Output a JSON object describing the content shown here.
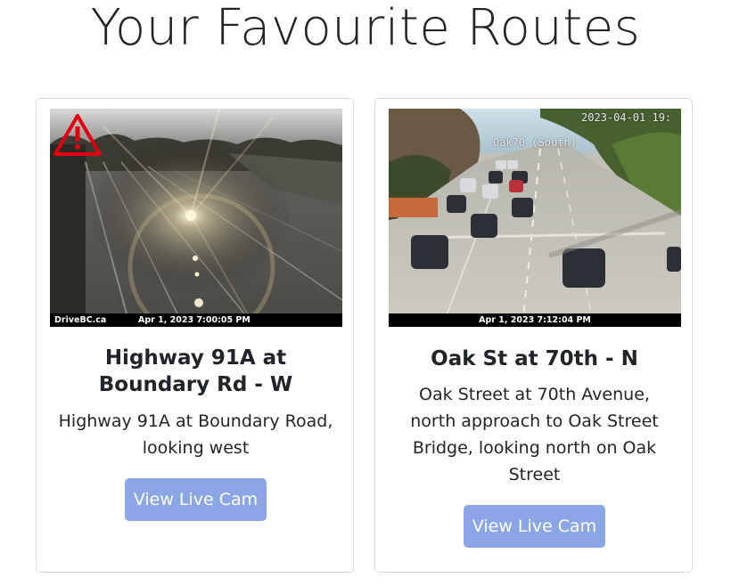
{
  "page": {
    "title": "Your Favourite Routes"
  },
  "routes": [
    {
      "title": "Highway 91A at Boundary Rd - W",
      "title_line1": "Highway 91A at",
      "title_line2": "Boundary Rd - W",
      "description": "Highway 91A at Boundary Road, looking west",
      "description_line1": "Highway 91A at Boundary Road,",
      "description_line2": "looking west",
      "cam_source": "DriveBC.ca",
      "cam_timestamp": "Apr 1, 2023 7:00:05 PM",
      "warning_icon": "warning-triangle-icon",
      "button_label": "View Live Cam"
    },
    {
      "title": "Oak St at 70th - N",
      "description": "Oak Street at 70th Avenue, north approach to Oak Street Bridge, looking north on Oak Street",
      "description_line1": "Oak Street at 70th Avenue,",
      "description_line2": "north approach to Oak Street",
      "description_line3": "Bridge, looking north on Oak",
      "description_line4": "Street",
      "cam_overlay_datetime": "2023-04-01 19:",
      "cam_overlay_label": "Oak70 (South)",
      "cam_timestamp": "Apr 1, 2023 7:12:04 PM",
      "button_label": "View Live Cam"
    }
  ],
  "colors": {
    "button_bg": "#8aa6e4",
    "button_text": "#ffffff",
    "card_border": "#dcdcdc",
    "warning_red": "#e3000f"
  }
}
